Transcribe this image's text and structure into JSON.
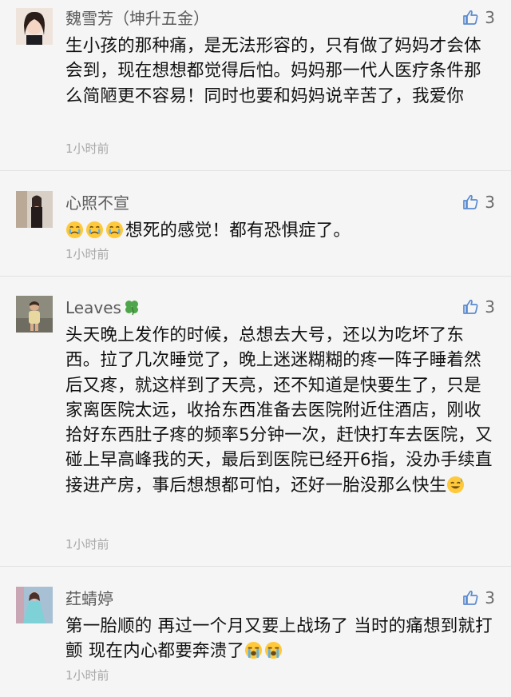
{
  "comments": [
    {
      "author": "魏雪芳（坤升五金）",
      "likes": "3",
      "text": "生小孩的那种痛，是无法形容的，只有做了妈妈才会体会到，现在想想都觉得后怕。妈妈那一代人医疗条件那么简陋更不容易！同时也要和妈妈说辛苦了，我爱你",
      "time": "1小时前",
      "avatar_icon": "woman-portrait-avatar"
    },
    {
      "author": "心照不宣",
      "likes": "3",
      "emojis": [
        "crying-face-emoji",
        "crying-face-emoji",
        "crying-face-emoji"
      ],
      "text": "想死的感觉！都有恐惧症了。",
      "time": "1小时前",
      "avatar_icon": "person-photo-avatar"
    },
    {
      "author": "Leaves",
      "author_icon": "four-leaf-clover-icon",
      "likes": "3",
      "text": "头天晚上发作的时候，总想去大号，还以为吃坏了东西。拉了几次睡觉了，晚上迷迷糊糊的疼一阵子睡着然后又疼，就这样到了天亮，还不知道是快要生了，只是家离医院太远，收拾东西准备去医院附近住酒店，刚收拾好东西肚子疼的频率5分钟一次，赶快打车去医院，又碰上早高峰我的天，最后到医院已经开6指，没办手续直接进产房，事后想想都可怕，还好一胎没那么快生",
      "trailing_emoji": "sweat-smile-emoji",
      "time": "1小时前",
      "avatar_icon": "child-photo-avatar"
    },
    {
      "author": "荭蜻婷",
      "likes": "3",
      "text": "第一胎顺的 再过一个月又要上战场了 当时的痛想到就打颤 现在内心都要奔溃了",
      "trailing_emojis": [
        "loudly-crying-emoji",
        "loudly-crying-emoji"
      ],
      "time": "1小时前",
      "avatar_icon": "girl-dress-avatar"
    }
  ],
  "colors": {
    "background": "#f5f5f5",
    "author": "#5a5a5a",
    "text": "#111111",
    "time": "#a8a8a8",
    "like": "#6a6a6a",
    "divider": "#e2e2e2"
  }
}
